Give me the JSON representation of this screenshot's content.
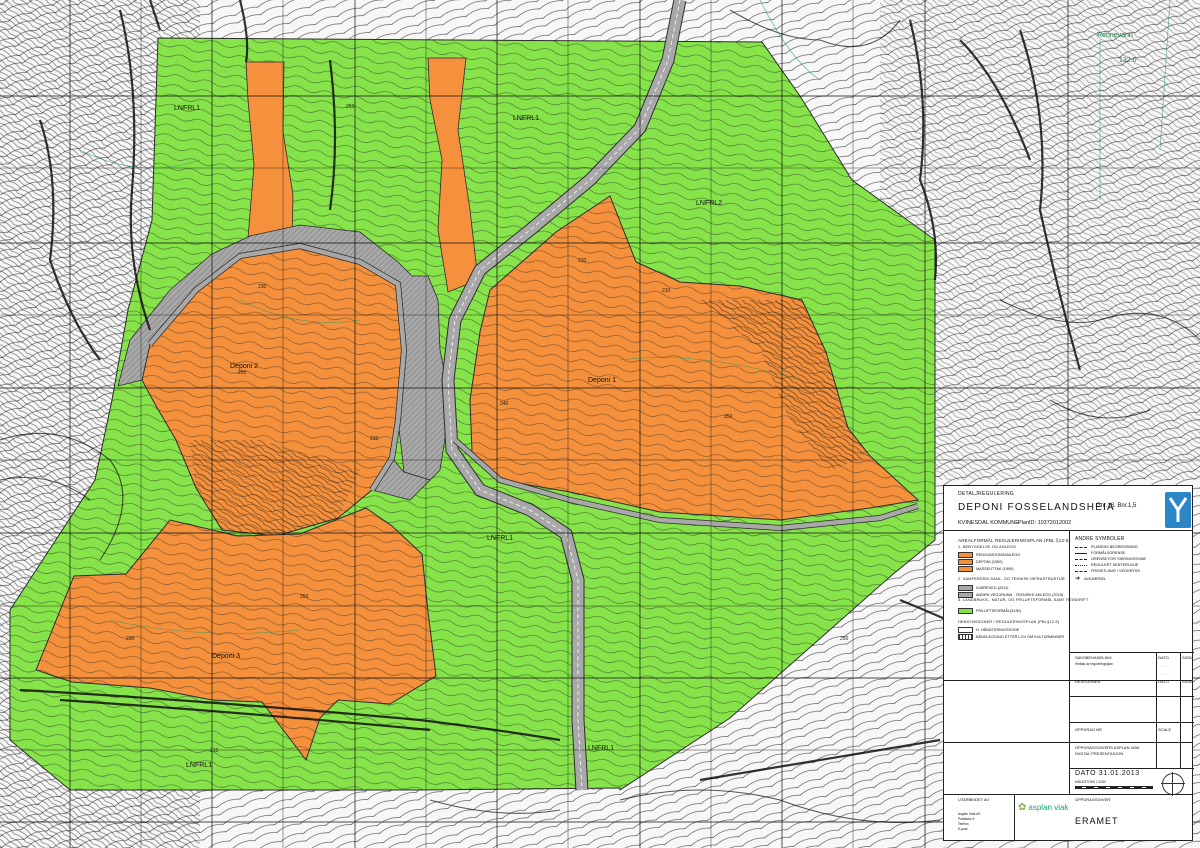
{
  "map": {
    "zone_labels": [
      "LNFRL1",
      "LNFRL1",
      "LNFRL2",
      "LNFRL1",
      "LNFRL1",
      "LNFRL1"
    ],
    "deponi_labels": [
      "Deponi 2",
      "Deponi 1",
      "Deponi 3"
    ],
    "lake_name": "Rennevann",
    "lake_elevation": "132.0",
    "contour_numbers": [
      "253",
      "230",
      "250",
      "230",
      "250",
      "240",
      "210",
      "230",
      "250",
      "250",
      "215",
      "210"
    ],
    "colors": {
      "deponi": "#f5913c",
      "friluft": "#86e44a",
      "kjoreveg": "#a8a8a8",
      "contour": "#111111",
      "grid": "#111111",
      "lake_text": "#1d7a4a"
    }
  },
  "title_block": {
    "kind": "DETALJREGULERING",
    "title": "DEPONI FOSSELANDSHEIA",
    "gnr": "Gnr.18, Bnr.1,5",
    "municipality": "KVINESDAL KOMMUNE",
    "plan_id": "PlanID: 10372012002",
    "legend_heading": "AREALFORMÅL REGULERINGSPLAN (PBL §12-5)",
    "legend_sec1": "1. BEBYGGELSE OG ANLEGG",
    "legend_items1": [
      {
        "label": "RENOVASJONSANLEGG",
        "color": "#f5913c"
      },
      {
        "label": "DEPONI (1550)",
        "color": "#f5913c"
      },
      {
        "label": "MASSEUTTAK (1590)",
        "color": "#f5913c"
      }
    ],
    "legend_sec2": "2. SAMFERDSELSANL. OG TEKNISK INFRASTRUKTUR",
    "legend_items2": [
      {
        "label": "KJØREVEG (2011)",
        "color": "#a8a8a8"
      },
      {
        "label": "ANNEN VEGGRUNN - TEKNISKE ANLEGG (2018)",
        "color": "#a8a8a8"
      }
    ],
    "legend_sec3": "5. LANDBRUKS-, NATUR- OG FRILUFTSFORMÅL SAMT REINDRIFT",
    "legend_items3": [
      {
        "label": "FRILUFTSFORMÅL(5130)",
        "color": "#86e44a"
      }
    ],
    "legend_sec4": "HENSYNSSONER I REGULERINGSPLAN (PBL§12-6)",
    "legend_items4": [
      "H. HÅNDTERINGSSONE",
      "BÅNDLEGGING ETTER LOV OM KULTURMINNER"
    ],
    "symbols_heading": "ANDRE SYMBOLER",
    "symbols": [
      "PLANENS BEGRENSNING",
      "FORMÅLSGRENSE",
      "GRENSE FOR SIKRINGSSONE",
      "REGULERT SENTERLINJE",
      "FRISIKTLINJE I VEGKRYSS",
      "AVKJØRSEL"
    ],
    "saksbehandling": "SAKSBEHANDLING",
    "saksbehandling_sub": "Vedtak av reguleringsplan",
    "dato": "DATO",
    "sign": "SIGN",
    "revisjoner": "REVISJONER",
    "oppdrag_nr": "OPPDRAG NR",
    "scale": "SCALE",
    "utarbeidet_av": "UTARBEIDET AV:",
    "oppdragsgiver_label": "OPPDRAGSGIVER:",
    "utarbeidet_dato": "DATO 31.01.2013",
    "firm_line1": "OPPDRAGSGIVERS ASPLAN VIAK",
    "firm_line2": "DIGITAL PRESENTASJON",
    "scale_text": "MÅLESTOKK 1:1000",
    "oppdragsgiver": "ERAMET",
    "brand": "asplan viak",
    "address_lines": [
      "Asplan Viak AS",
      "Postboks 9",
      "Telefon",
      "E-post"
    ]
  }
}
